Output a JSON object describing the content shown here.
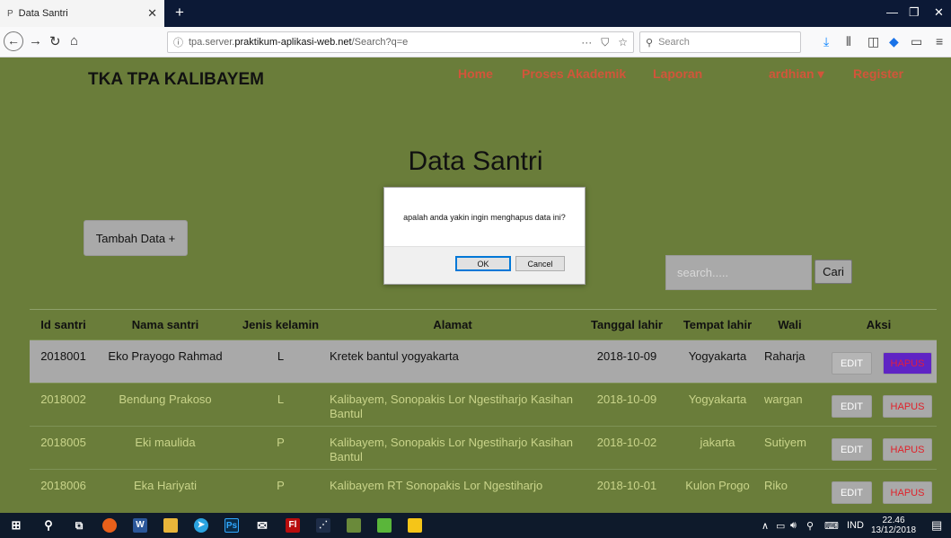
{
  "browser": {
    "tab_title": "Data Santri",
    "url_prefix": "tpa.server.",
    "url_domain": "praktikum-aplikasi-web.net",
    "url_path": "/Search?q=e",
    "search_placeholder": "Search"
  },
  "site": {
    "brand": "TKA TPA KALIBAYEM",
    "menu": {
      "home": "Home",
      "akademik": "Proses Akademik",
      "laporan": "Laporan",
      "user": "ardhian ▾",
      "register": "Register"
    }
  },
  "page": {
    "title": "Data Santri",
    "add_button": "Tambah Data +",
    "search_placeholder": "search.....",
    "search_button": "Cari"
  },
  "table": {
    "headers": {
      "id": "Id santri",
      "name": "Nama santri",
      "jk": "Jenis kelamin",
      "alamat": "Alamat",
      "tgl": "Tanggal lahir",
      "tempat": "Tempat lahir",
      "wali": "Wali",
      "aksi": "Aksi"
    },
    "edit_label": "EDIT",
    "delete_label": "HAPUS",
    "rows": [
      {
        "id": "2018001",
        "name": "Eko Prayogo Rahmad",
        "jk": "L",
        "alamat": "Kretek bantul yogyakarta",
        "tgl": "2018-10-09",
        "tempat": "Yogyakarta",
        "wali": "Raharja"
      },
      {
        "id": "2018002",
        "name": "Bendung Prakoso",
        "jk": "L",
        "alamat": "Kalibayem, Sonopakis Lor Ngestiharjo Kasihan Bantul",
        "tgl": "2018-10-09",
        "tempat": "Yogyakarta",
        "wali": "wargan"
      },
      {
        "id": "2018005",
        "name": "Eki maulida",
        "jk": "P",
        "alamat": "Kalibayem, Sonopakis Lor Ngestiharjo Kasihan Bantul",
        "tgl": "2018-10-02",
        "tempat": "jakarta",
        "wali": "Sutiyem"
      },
      {
        "id": "2018006",
        "name": "Eka Hariyati",
        "jk": "P",
        "alamat": "Kalibayem RT Sonopakis Lor Ngestiharjo",
        "tgl": "2018-10-01",
        "tempat": "Kulon Progo",
        "wali": "Riko"
      }
    ]
  },
  "dialog": {
    "message": "apalah anda yakin ingin menghapus data ini?",
    "ok": "OK",
    "cancel": "Cancel"
  },
  "taskbar": {
    "lang": "IND",
    "time": "22.46",
    "date": "13/12/2018"
  }
}
